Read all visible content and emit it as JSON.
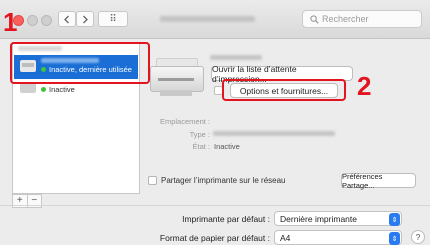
{
  "toolbar": {
    "grid_glyph": "⠿",
    "search_placeholder": "Rechercher"
  },
  "annotations": {
    "one": "1",
    "two": "2"
  },
  "printer_list": {
    "selected": {
      "status": "Inactive, dernière utilisée"
    },
    "second": {
      "status": "Inactive"
    },
    "add_button": "+",
    "remove_button": "−"
  },
  "details": {
    "open_queue_button": "Ouvrir la liste d’attente d’impression...",
    "options_button": "Options et fournitures...",
    "location_label": "Emplacement :",
    "type_label": "Type :",
    "state_label": "État :",
    "state_value": "Inactive"
  },
  "sharing": {
    "checkbox_label": "Partager l’imprimante sur le réseau",
    "sharing_prefs_button": "Préférences Partage..."
  },
  "defaults": {
    "default_printer_label": "Imprimante par défaut :",
    "default_printer_value": "Dernière imprimante",
    "paper_size_label": "Format de papier par défaut :",
    "paper_size_value": "A4",
    "help_button": "?"
  },
  "colors": {
    "annotation_red": "#e11420",
    "selection_blue": "#1a6ed6",
    "status_green": "#3cc43c"
  }
}
